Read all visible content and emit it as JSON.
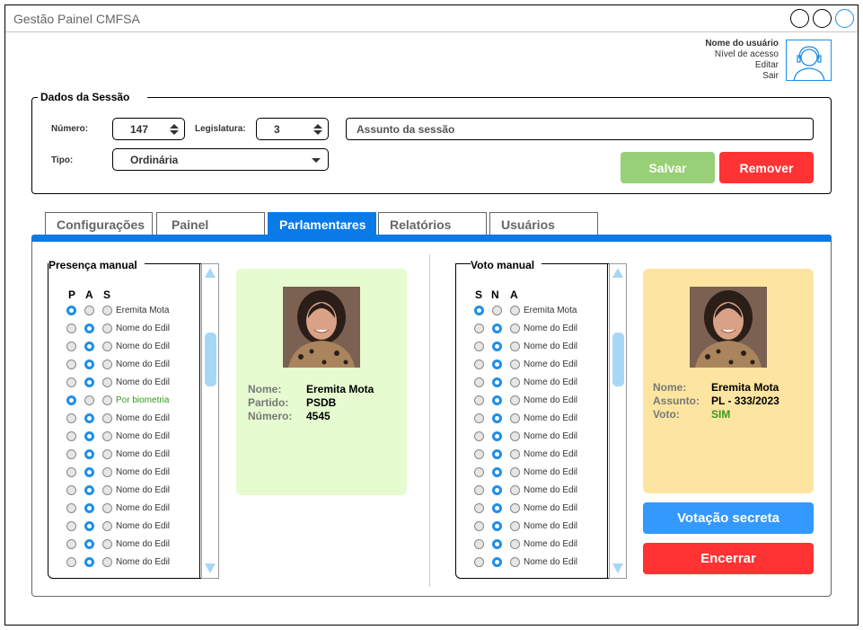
{
  "app": {
    "title": "Gestão Painel CMFSA"
  },
  "user": {
    "name": "Nome do usuário",
    "level": "Nível de acesso",
    "edit": "Editar",
    "logout": "Sair"
  },
  "session": {
    "legend": "Dados da Sessão",
    "numero_label": "Número:",
    "numero_value": "147",
    "legislatura_label": "Legislatura:",
    "legislatura_value": "3",
    "assunto_placeholder": "Assunto da sessão",
    "tipo_label": "Tipo:",
    "tipo_value": "Ordinária",
    "save_label": "Salvar",
    "remove_label": "Remover"
  },
  "tabs": [
    {
      "label": "Configurações"
    },
    {
      "label": "Painel"
    },
    {
      "label": "Parlamentares"
    },
    {
      "label": "Relatórios"
    },
    {
      "label": "Usuários"
    }
  ],
  "presence": {
    "title": "Presença manual",
    "columns": [
      "P",
      "A",
      "S"
    ],
    "rows": [
      {
        "name": "Eremita Mota",
        "selected": 0,
        "highlight": false
      },
      {
        "name": "Nome do Edil",
        "selected": 1,
        "highlight": false
      },
      {
        "name": "Nome do Edil",
        "selected": 1,
        "highlight": false
      },
      {
        "name": "Nome do Edil",
        "selected": 1,
        "highlight": false
      },
      {
        "name": "Nome do Edil",
        "selected": 1,
        "highlight": false
      },
      {
        "name": "Por biometria",
        "selected": 0,
        "highlight": true
      },
      {
        "name": "Nome do Edil",
        "selected": 1,
        "highlight": false
      },
      {
        "name": "Nome do Edil",
        "selected": 1,
        "highlight": false
      },
      {
        "name": "Nome do Edil",
        "selected": 1,
        "highlight": false
      },
      {
        "name": "Nome do Edil",
        "selected": 1,
        "highlight": false
      },
      {
        "name": "Nome do Edil",
        "selected": 1,
        "highlight": false
      },
      {
        "name": "Nome do Edil",
        "selected": 1,
        "highlight": false
      },
      {
        "name": "Nome do Edil",
        "selected": 1,
        "highlight": false
      },
      {
        "name": "Nome do Edil",
        "selected": 1,
        "highlight": false
      },
      {
        "name": "Nome do Edil",
        "selected": 1,
        "highlight": false
      }
    ]
  },
  "member_card": {
    "nome_label": "Nome:",
    "nome_value": "Eremita Mota",
    "partido_label": "Partido:",
    "partido_value": "PSDB",
    "numero_label": "Número:",
    "numero_value": "4545",
    "bg_color": "#e6fbd0"
  },
  "vote": {
    "title": "Voto manual",
    "columns": [
      "S",
      "N",
      "A"
    ],
    "rows": [
      {
        "name": "Eremita Mota",
        "selected": 0
      },
      {
        "name": "Nome do Edil",
        "selected": 1
      },
      {
        "name": "Nome do Edil",
        "selected": 1
      },
      {
        "name": "Nome do Edil",
        "selected": 1
      },
      {
        "name": "Nome do Edil",
        "selected": 1
      },
      {
        "name": "Nome do Edil",
        "selected": 1
      },
      {
        "name": "Nome do Edil",
        "selected": 1
      },
      {
        "name": "Nome do Edil",
        "selected": 1
      },
      {
        "name": "Nome do Edil",
        "selected": 1
      },
      {
        "name": "Nome do Edil",
        "selected": 1
      },
      {
        "name": "Nome do Edil",
        "selected": 1
      },
      {
        "name": "Nome do Edil",
        "selected": 1
      },
      {
        "name": "Nome do Edil",
        "selected": 1
      },
      {
        "name": "Nome do Edil",
        "selected": 1
      },
      {
        "name": "Nome do Edil",
        "selected": 1
      }
    ]
  },
  "vote_card": {
    "nome_label": "Nome:",
    "nome_value": "Eremita Mota",
    "assunto_label": "Assunto:",
    "assunto_value": "PL - 333/2023",
    "voto_label": "Voto:",
    "voto_value": "SIM",
    "bg_color": "#fde5a1"
  },
  "actions": {
    "secret_vote_label": "Votação secreta",
    "close_label": "Encerrar"
  },
  "colors": {
    "primary": "#0a7ae6",
    "save": "#97d077",
    "danger": "#ff3333",
    "secret": "#3399ff",
    "radio_on": "#1f8eea",
    "green_text": "#3a9a1a"
  }
}
